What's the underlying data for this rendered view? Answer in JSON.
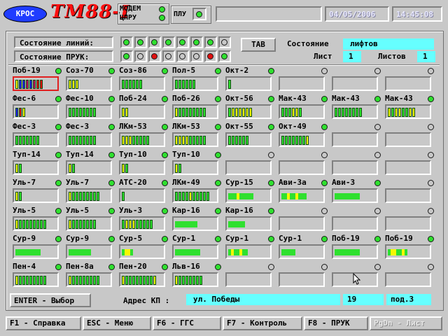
{
  "header": {
    "logo_text": "КРОС",
    "title": "ТМ88-I",
    "modem_label_1": "МОДЕМ",
    "modem_label_2": "ЦПРУ",
    "plu_label": "ПЛУ",
    "date": "04/05/2006",
    "time": "14:45:08"
  },
  "status": {
    "line_state_label": "Состояние линий:",
    "pruk_state_label": "Состояние ПРУК:",
    "tab_label": "TAB",
    "state_label": "Состояние",
    "state_value": "лифтов",
    "sheet_label": "Лист",
    "sheet_value": "1",
    "sheets_label": "Листов",
    "sheets_value": "1",
    "line_leds": [
      "green",
      "green",
      "green",
      "green",
      "green",
      "green",
      "green",
      "gray"
    ],
    "pruk_leds": [
      "green",
      "gray",
      "red",
      "gray",
      "gray",
      "gray",
      "red",
      "green"
    ]
  },
  "grid": {
    "rows": [
      [
        {
          "name": "Поб-19",
          "led": "green",
          "bars": "ybbmbmrr",
          "selected": true
        },
        {
          "name": "Соз-70",
          "led": "green",
          "bars": "yyy"
        },
        {
          "name": "Соз-86",
          "led": "green",
          "bars": "gggggg"
        },
        {
          "name": "Пол-5",
          "led": "green",
          "bars": "gggggg"
        },
        {
          "name": "Окт-2",
          "led": "green",
          "bars": "g"
        },
        {
          "name": "",
          "led": "gray",
          "bars": ""
        },
        {
          "name": "",
          "led": "gray",
          "bars": ""
        },
        {
          "name": "",
          "led": "gray",
          "bars": ""
        }
      ],
      [
        {
          "name": "Фес-6",
          "led": "green",
          "bars": "bry"
        },
        {
          "name": "Фес-10",
          "led": "green",
          "bars": "gggggggg"
        },
        {
          "name": "Поб-24",
          "led": "green",
          "bars": "yy"
        },
        {
          "name": "Поб-26",
          "led": "green",
          "bars": "ygggggggg"
        },
        {
          "name": "Окт-56",
          "led": "green",
          "bars": "gyyyyyy"
        },
        {
          "name": "Мак-43",
          "led": "green",
          "bars": "gggyyg"
        },
        {
          "name": "Мак-43",
          "led": "green",
          "bars": "gggggggg"
        },
        {
          "name": "Мак-43",
          "led": "green",
          "bars": "ygyyggyy"
        }
      ],
      [
        {
          "name": "Фес-3",
          "led": "green",
          "bars": "ggggggg"
        },
        {
          "name": "Фес-3",
          "led": "green",
          "bars": "gggggggg"
        },
        {
          "name": "ЛКм-53",
          "led": "green",
          "bars": "yyyggggg"
        },
        {
          "name": "ЛКм-53",
          "led": "green",
          "bars": "yyyyggggg"
        },
        {
          "name": "Окт-55",
          "led": "green",
          "bars": "gggggg"
        },
        {
          "name": "Окт-49",
          "led": "green",
          "bars": "gggggggy"
        },
        {
          "name": "",
          "led": "gray",
          "bars": ""
        },
        {
          "name": "",
          "led": "gray",
          "bars": ""
        }
      ],
      [
        {
          "name": "Туп-14",
          "led": "green",
          "bars": "yg"
        },
        {
          "name": "Туп-14",
          "led": "green",
          "bars": "yg"
        },
        {
          "name": "Туп-10",
          "led": "green",
          "bars": "yg"
        },
        {
          "name": "Туп-10",
          "led": "green",
          "bars": "yg"
        },
        {
          "name": "",
          "led": "gray",
          "bars": ""
        },
        {
          "name": "",
          "led": "gray",
          "bars": ""
        },
        {
          "name": "",
          "led": "gray",
          "bars": ""
        },
        {
          "name": "",
          "led": "gray",
          "bars": ""
        }
      ],
      [
        {
          "name": "Уль-7",
          "led": "green",
          "bars": "yg"
        },
        {
          "name": "Уль-7",
          "led": "green",
          "bars": "ygggggggg"
        },
        {
          "name": "АТС-20",
          "led": "green",
          "bars": "g"
        },
        {
          "name": "ЛКм-49",
          "led": "green",
          "bars": "ggggyggggg"
        },
        {
          "name": "Сур-15",
          "led": "green",
          "bars": "F:gggyggggg"
        },
        {
          "name": "Ави-3а",
          "led": "green",
          "bars": "F:ggyggyggg"
        },
        {
          "name": "Ави-3",
          "led": "green",
          "bars": "F:ggggggggg"
        },
        {
          "name": "",
          "led": "gray",
          "bars": ""
        }
      ],
      [
        {
          "name": "Уль-5",
          "led": "green",
          "bars": "ygggggggg"
        },
        {
          "name": "Уль-5",
          "led": "green",
          "bars": "yggggggg"
        },
        {
          "name": "Уль-3",
          "led": "green",
          "bars": "gyyyggggg"
        },
        {
          "name": "Кар-16",
          "led": "green",
          "bars": "F:gggggggg"
        },
        {
          "name": "Кар-16",
          "led": "green",
          "bars": "F:gggggg"
        },
        {
          "name": "",
          "led": "gray",
          "bars": ""
        },
        {
          "name": "",
          "led": "gray",
          "bars": ""
        },
        {
          "name": "",
          "led": "gray",
          "bars": ""
        }
      ],
      [
        {
          "name": "Сур-9",
          "led": "green",
          "bars": "F:ggggggggg"
        },
        {
          "name": "Сур-9",
          "led": "green",
          "bars": "F:gggggggg"
        },
        {
          "name": "Сур-5",
          "led": "green",
          "bars": "F:gyyg"
        },
        {
          "name": "Сур-1",
          "led": "green",
          "bars": "F:ggggggggg"
        },
        {
          "name": "Сур-1",
          "led": "green",
          "bars": "F:gyggygg"
        },
        {
          "name": "Сур-1",
          "led": "green",
          "bars": "F:ggggg"
        },
        {
          "name": "Поб-19",
          "led": "green",
          "bars": "F:ggggggggg"
        },
        {
          "name": "Поб-19",
          "led": "green",
          "bars": "F:gyyggyg"
        }
      ],
      [
        {
          "name": "Пен-4",
          "led": "green",
          "bars": "ygggggggg"
        },
        {
          "name": "Пен-8а",
          "led": "green",
          "bars": "ygggggggg"
        },
        {
          "name": "Пен-20",
          "led": "green",
          "bars": "yggggggggy"
        },
        {
          "name": "Льв-16",
          "led": "green",
          "bars": "yggggggg"
        },
        {
          "name": "",
          "led": "gray",
          "bars": ""
        },
        {
          "name": "",
          "led": "gray",
          "bars": ""
        },
        {
          "name": "",
          "led": "gray",
          "bars": ""
        },
        {
          "name": "",
          "led": "gray",
          "bars": ""
        }
      ]
    ]
  },
  "footer": {
    "enter_label": "ENTER - Выбор",
    "address_label": "Адрес КП :",
    "street": "ул. Победы",
    "house": "19",
    "entrance": "под.3"
  },
  "fkeys": [
    {
      "label": "F1 - Справка",
      "enabled": true
    },
    {
      "label": "ESC - Меню",
      "enabled": true
    },
    {
      "label": "F6 - ГГС",
      "enabled": true
    },
    {
      "label": "F7 - Контроль",
      "enabled": true
    },
    {
      "label": "F8 - ПРУК",
      "enabled": true
    },
    {
      "label": "PgDn - Лист",
      "enabled": false
    }
  ],
  "colors": {
    "green": "#2fe02f",
    "yellow": "#f7f700",
    "red": "#e01010",
    "blue": "#2020f0",
    "gray": "#c8c8c8",
    "cyan": "#66ffff",
    "logo": "#1f3cff",
    "title": "#ff1010",
    "date": "#c8c8ff"
  }
}
